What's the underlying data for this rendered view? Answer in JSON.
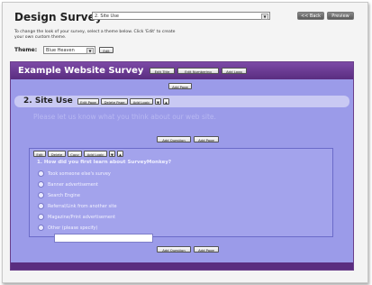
{
  "header": {
    "title": "Design Survey",
    "page_select_value": "2. Site Use",
    "back_label": "<< Back",
    "preview_label": "Preview"
  },
  "instructions": "To change the look of your survey, select a theme below. Click 'Edit' to create your own custom theme.",
  "theme": {
    "label": "Theme:",
    "value": "Blue Heaven",
    "edit_label": "Edit"
  },
  "survey": {
    "title": "Example Website Survey",
    "buttons": [
      "Edit Title",
      "Edit Numbering",
      "Add Logo"
    ],
    "add_page_label": "Add Page"
  },
  "page": {
    "title": "2. Site Use",
    "buttons": [
      "Edit Page",
      "Delete Page",
      "Add Logic",
      "▼",
      "▲"
    ],
    "description": "Please let us know what you think about our web site.",
    "add_question_label": "Add Question",
    "add_page_label": "Add Page"
  },
  "question": {
    "buttons": [
      "Edit",
      "Delete",
      "Copy",
      "Add Logic",
      "▼",
      "▲"
    ],
    "text": "1. How did you first learn about SurveyMonkey?",
    "options": [
      "Took someone else's survey",
      "Banner advertisement",
      "Search Engine",
      "Referral/Link from another site",
      "Magazine/Print advertisement",
      "Other (please specify)"
    ],
    "add_question_label": "Add Question",
    "add_page_label": "Add Page"
  },
  "colors": {
    "accent": "#5a2d80",
    "survey_bg": "#9b9be9"
  }
}
